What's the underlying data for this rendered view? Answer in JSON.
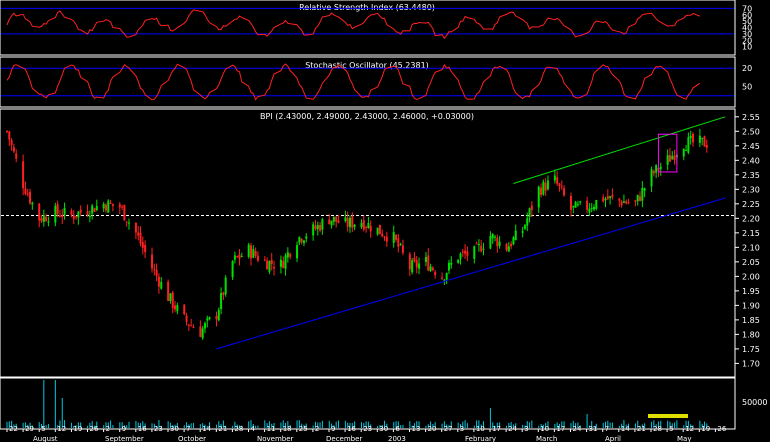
{
  "panels": {
    "rsi": {
      "title": "Relative Strength Index (63.4480)",
      "ticks": [
        70,
        60,
        50,
        40,
        30,
        20,
        10
      ],
      "levels": [
        30,
        70
      ],
      "ylim": [
        0,
        80
      ]
    },
    "stoch": {
      "title": "Stochastic Oscillator (45.2381)",
      "ticks": [
        20,
        50
      ],
      "levels": [
        20,
        80
      ],
      "ylim": [
        0,
        100
      ]
    },
    "price": {
      "title": "BPI (2.43000, 2.49000, 2.43000, 2.46000, +0.03000)"
    },
    "volume": {
      "tick_label": "50000"
    }
  },
  "colors": {
    "up": "#00e000",
    "down": "#ff2020",
    "band": "#0000ff",
    "trend_up": "#00e000",
    "trend_low": "#0000ff",
    "highlight": "#ff00ff",
    "grid": "#ffffff",
    "text": "#ffffff",
    "indicator": "#ff2020",
    "volume": "#00c8e0",
    "frame": "#ffffff"
  },
  "x_axis": {
    "day_labels": [
      "22",
      "29",
      "5",
      "12",
      "19",
      "26",
      "2",
      "9",
      "16",
      "23",
      "30",
      "7",
      "14",
      "21",
      "28",
      "4",
      "11",
      "18",
      "25",
      "2",
      "9",
      "16",
      "23",
      "30",
      "6",
      "13",
      "20",
      "27",
      "3",
      "10",
      "17",
      "24",
      "3",
      "10",
      "17",
      "24",
      "31",
      "7",
      "14",
      "21",
      "28",
      "5",
      "12",
      "19",
      "26"
    ],
    "month_labels": [
      "August",
      "September",
      "October",
      "November",
      "December",
      "2003",
      "February",
      "March",
      "April",
      "May"
    ]
  },
  "chart_data": {
    "type": "candlestick",
    "title": "BPI (2.43000, 2.49000, 2.43000, 2.46000, +0.03000)",
    "ylim": [
      1.66,
      2.57
    ],
    "y_ticks": [
      2.55,
      2.5,
      2.45,
      2.4,
      2.35,
      2.3,
      2.25,
      2.2,
      2.15,
      2.1,
      2.05,
      2.0,
      1.95,
      1.9,
      1.85,
      1.8,
      1.75,
      1.7
    ],
    "support_line": 2.21,
    "trend_upper": {
      "from": [
        "2003-02-27",
        2.32
      ],
      "to": [
        "2003-05-30",
        2.55
      ]
    },
    "trend_lower": {
      "from": [
        "2002-10-21",
        1.75
      ],
      "to": [
        "2003-05-30",
        2.27
      ]
    },
    "highlight_box": {
      "from": [
        "2003-05-01",
        2.36
      ],
      "to": [
        "2003-05-09",
        2.49
      ]
    },
    "close_path": [
      [
        "2002-07-22",
        2.5
      ],
      [
        "2002-07-29",
        2.32
      ],
      [
        "2002-08-05",
        2.2
      ],
      [
        "2002-08-12",
        2.22
      ],
      [
        "2002-08-19",
        2.21
      ],
      [
        "2002-08-26",
        2.23
      ],
      [
        "2002-09-02",
        2.25
      ],
      [
        "2002-09-09",
        2.24
      ],
      [
        "2002-09-16",
        2.15
      ],
      [
        "2002-09-23",
        2.03
      ],
      [
        "2002-09-30",
        1.93
      ],
      [
        "2002-10-07",
        1.85
      ],
      [
        "2002-10-14",
        1.81
      ],
      [
        "2002-10-21",
        1.87
      ],
      [
        "2002-10-28",
        2.05
      ],
      [
        "2002-11-04",
        2.09
      ],
      [
        "2002-11-11",
        2.05
      ],
      [
        "2002-11-18",
        2.04
      ],
      [
        "2002-11-25",
        2.13
      ],
      [
        "2002-12-02",
        2.16
      ],
      [
        "2002-12-09",
        2.2
      ],
      [
        "2002-12-16",
        2.18
      ],
      [
        "2002-12-23",
        2.19
      ],
      [
        "2002-12-30",
        2.16
      ],
      [
        "2003-01-06",
        2.13
      ],
      [
        "2003-01-13",
        2.03
      ],
      [
        "2003-01-20",
        2.05
      ],
      [
        "2003-01-27",
        2.0
      ],
      [
        "2003-02-03",
        2.07
      ],
      [
        "2003-02-10",
        2.08
      ],
      [
        "2003-02-17",
        2.14
      ],
      [
        "2003-02-24",
        2.1
      ],
      [
        "2003-03-03",
        2.16
      ],
      [
        "2003-03-10",
        2.3
      ],
      [
        "2003-03-17",
        2.33
      ],
      [
        "2003-03-24",
        2.23
      ],
      [
        "2003-03-31",
        2.24
      ],
      [
        "2003-04-07",
        2.27
      ],
      [
        "2003-04-14",
        2.26
      ],
      [
        "2003-04-21",
        2.25
      ],
      [
        "2003-04-28",
        2.35
      ],
      [
        "2003-05-05",
        2.4
      ],
      [
        "2003-05-12",
        2.46
      ]
    ],
    "rsi": {
      "last": 63.448
    },
    "stochastic": {
      "last": 45.2381
    }
  }
}
